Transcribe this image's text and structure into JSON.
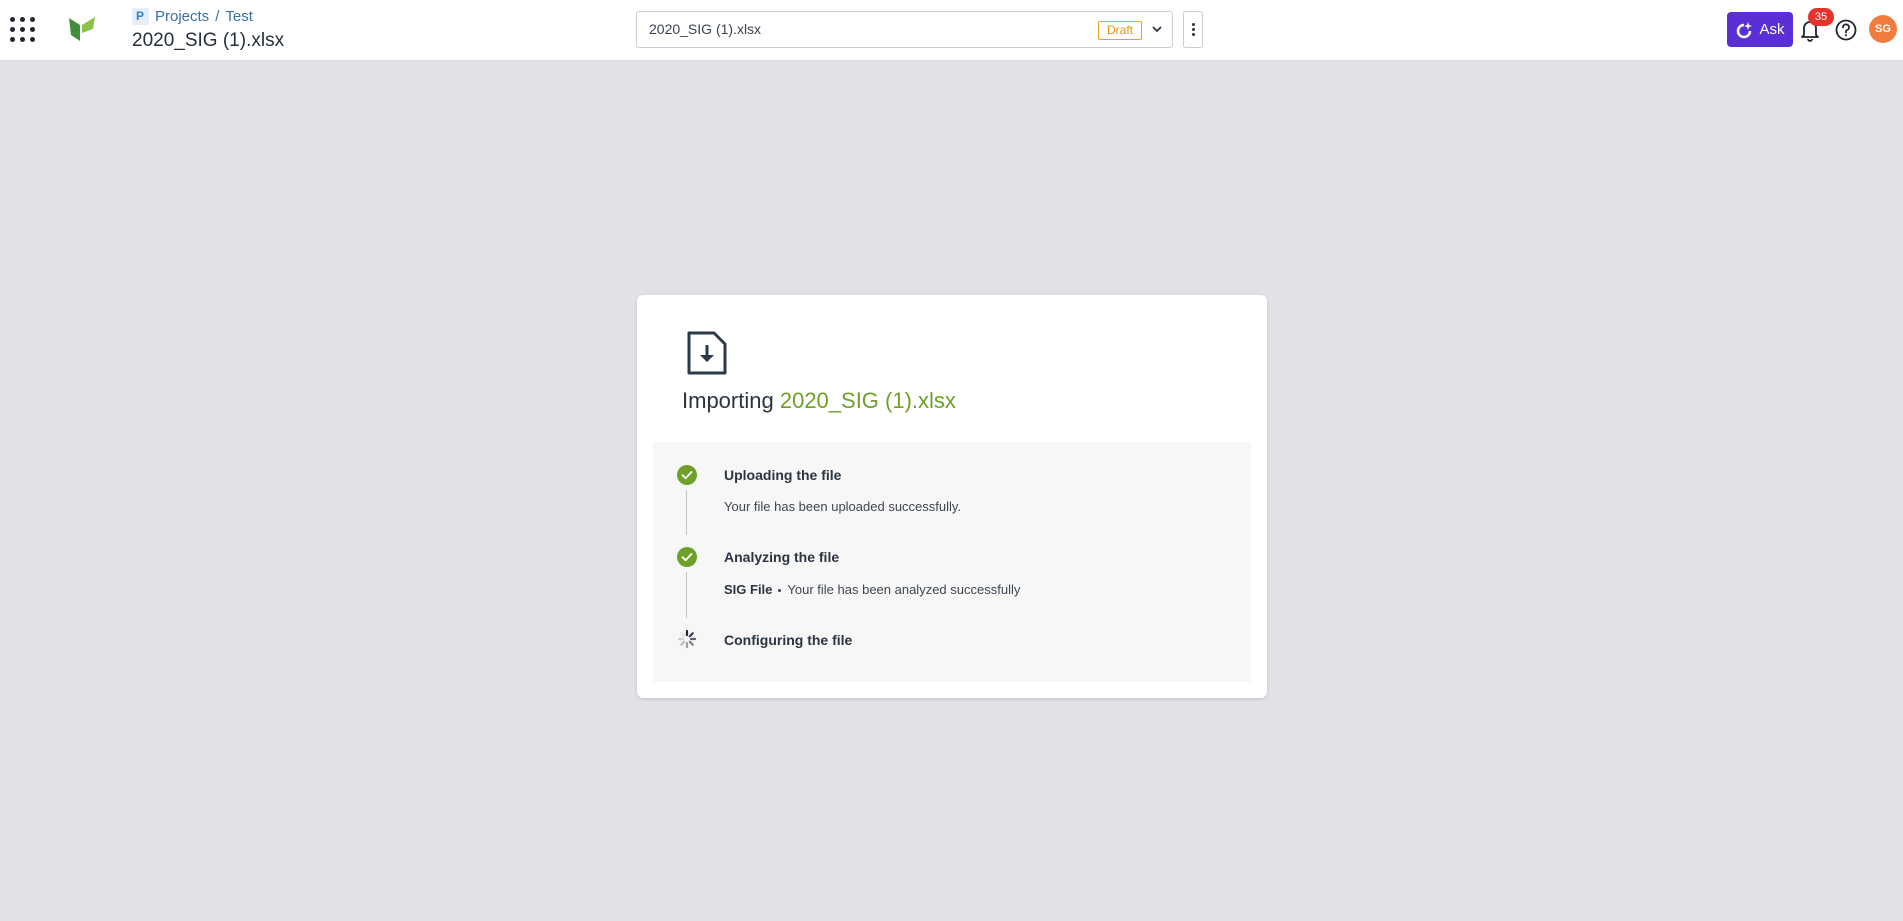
{
  "header": {
    "breadcrumb": {
      "projects": "Projects",
      "separator": "/",
      "project": "Test"
    },
    "title": "2020_SIG (1).xlsx",
    "file_selector": {
      "value": "2020_SIG (1).xlsx",
      "status_badge": "Draft"
    },
    "ask_label": "Ask",
    "notification_count": "35",
    "avatar_initials": "SG"
  },
  "import": {
    "title_prefix": "Importing",
    "file_name": "2020_SIG (1).xlsx",
    "steps": [
      {
        "title": "Uploading the file",
        "status": "done",
        "description": "Your file has been uploaded successfully."
      },
      {
        "title": "Analyzing the file",
        "status": "done",
        "tag": "SIG File",
        "description": "Your file has been analyzed successfully"
      },
      {
        "title": "Configuring the file",
        "status": "in-progress"
      }
    ]
  },
  "colors": {
    "accent_green": "#6ea02a",
    "success_check": "#6ea02a",
    "ask_purple": "#5b2fd6",
    "draft_badge": "#e8a22b",
    "notification_red": "#e5322d",
    "avatar": "#f07c3d"
  },
  "icons": {
    "apps": "apps-grid-icon",
    "logo": "leaf-logo-icon",
    "project": "project-icon",
    "chevron": "chevron-down-icon",
    "more": "more-vertical-icon",
    "ask": "ask-ai-icon",
    "bell": "bell-icon",
    "help": "help-icon",
    "file_import": "file-import-icon",
    "done": "check-circle-icon",
    "loading": "spinner-icon"
  }
}
